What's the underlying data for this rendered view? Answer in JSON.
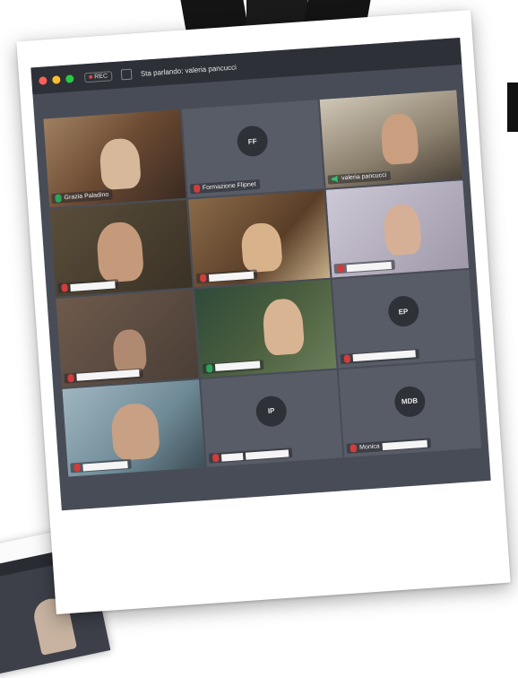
{
  "toolbar": {
    "rec_label": "REC",
    "speaking_label": "Sta parlando: valeria pancucci"
  },
  "participants": [
    {
      "name": "Grazia Paladino",
      "mic": "on",
      "kind": "video"
    },
    {
      "name": "Formazione Flipnet",
      "mic": "muted",
      "kind": "avatar",
      "initials": "FF"
    },
    {
      "name": "valeria pancucci",
      "mic": "speaking",
      "kind": "video"
    },
    {
      "name": "",
      "mic": "muted",
      "kind": "video"
    },
    {
      "name": "",
      "mic": "muted",
      "kind": "video"
    },
    {
      "name": "",
      "mic": "muted",
      "kind": "video"
    },
    {
      "name": "",
      "mic": "muted",
      "kind": "video"
    },
    {
      "name": "",
      "mic": "on",
      "kind": "video"
    },
    {
      "name": "",
      "mic": "muted",
      "kind": "avatar",
      "initials": "EP"
    },
    {
      "name": "",
      "mic": "muted",
      "kind": "video"
    },
    {
      "name": "",
      "mic": "muted",
      "kind": "avatar",
      "initials": "IP"
    },
    {
      "name": "Monica",
      "mic": "muted",
      "kind": "avatar",
      "initials": "MDB"
    }
  ],
  "colors": {
    "window_bg": "#484c56",
    "titlebar_bg": "#2d3037",
    "muted_red": "#d23c3c",
    "active_green": "#2aa55a"
  }
}
